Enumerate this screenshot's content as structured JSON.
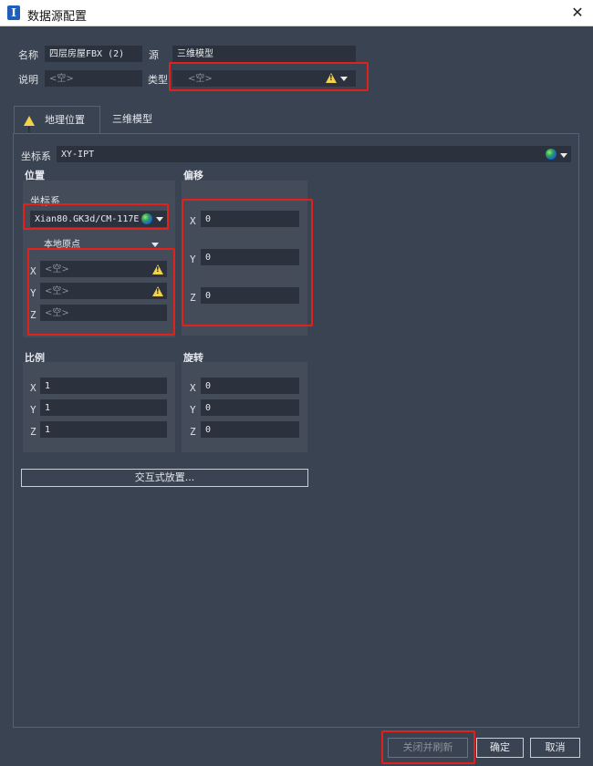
{
  "window": {
    "title": "数据源配置",
    "close_glyph": "✕",
    "app_glyph": "I"
  },
  "header": {
    "name_label": "名称",
    "name_value": "四层房屋FBX (2)",
    "source_label": "源",
    "source_value": "三维模型",
    "desc_label": "说明",
    "desc_value": "<空>",
    "type_label": "类型",
    "type_value": "<空>"
  },
  "tabs": [
    {
      "label": "地理位置",
      "active": true
    },
    {
      "label": "三维模型",
      "active": false
    }
  ],
  "geo": {
    "crs_label": "坐标系",
    "crs_value": "XY-IPT",
    "position": {
      "title": "位置",
      "crs_label": "坐标系",
      "crs_value": "Xian80.GK3d/CM-117E",
      "origin_value": "本地原点",
      "x_label": "X",
      "x_value": "<空>",
      "y_label": "Y",
      "y_value": "<空>",
      "z_label": "Z",
      "z_value": "<空>"
    },
    "offset": {
      "title": "偏移",
      "x_label": "X",
      "x_value": "0",
      "y_label": "Y",
      "y_value": "0",
      "z_label": "Z",
      "z_value": "0"
    },
    "scale": {
      "title": "比例",
      "x_label": "X",
      "x_value": "1",
      "y_label": "Y",
      "y_value": "1",
      "z_label": "Z",
      "z_value": "1"
    },
    "rotation": {
      "title": "旋转",
      "x_label": "X",
      "x_value": "0",
      "y_label": "Y",
      "y_value": "0",
      "z_label": "Z",
      "z_value": "0"
    },
    "interactive_button": "交互式放置..."
  },
  "footer": {
    "close_refresh": "关闭并刷新",
    "ok": "确定",
    "cancel": "取消"
  },
  "colors": {
    "accent_red": "#e3211a",
    "warning": "#f1d24a",
    "background": "#3a4351",
    "field": "#2b323d"
  }
}
